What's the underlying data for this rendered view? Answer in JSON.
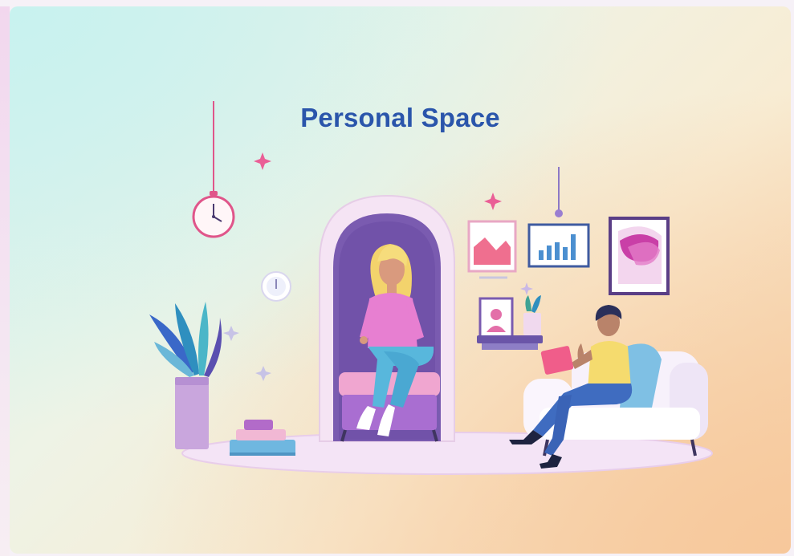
{
  "illustration": {
    "title": "Personal Space"
  },
  "colors": {
    "title": "#2a55ab",
    "background_top_left": "#c8f2ef",
    "background_bottom_right": "#f7c89b",
    "accent_pink": "#e25b88",
    "accent_purple": "#7a5bb0"
  },
  "icons": [
    "wall-clock-icon",
    "sparkle-icon",
    "star-icon",
    "bar-chart-frame-icon",
    "potted-plant-icon"
  ]
}
